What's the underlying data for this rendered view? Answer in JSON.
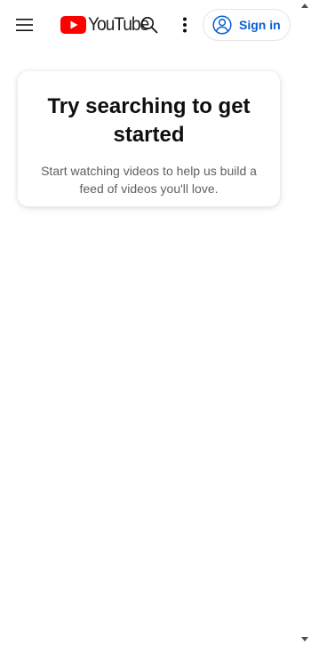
{
  "header": {
    "logo_text": "YouTube",
    "menu_icon": "hamburger-menu-icon",
    "search_icon": "search-icon",
    "more_icon": "more-vertical-icon",
    "signin_label": "Sign in",
    "signin_icon": "account-circle-icon"
  },
  "colors": {
    "brand_red": "#ff0000",
    "link_blue": "#065fd4",
    "text_primary": "#0f0f0f",
    "text_secondary": "#606060"
  },
  "main": {
    "prompt_title": "Try searching to get started",
    "prompt_subtitle": "Start watching videos to help us build a feed of videos you'll love."
  }
}
